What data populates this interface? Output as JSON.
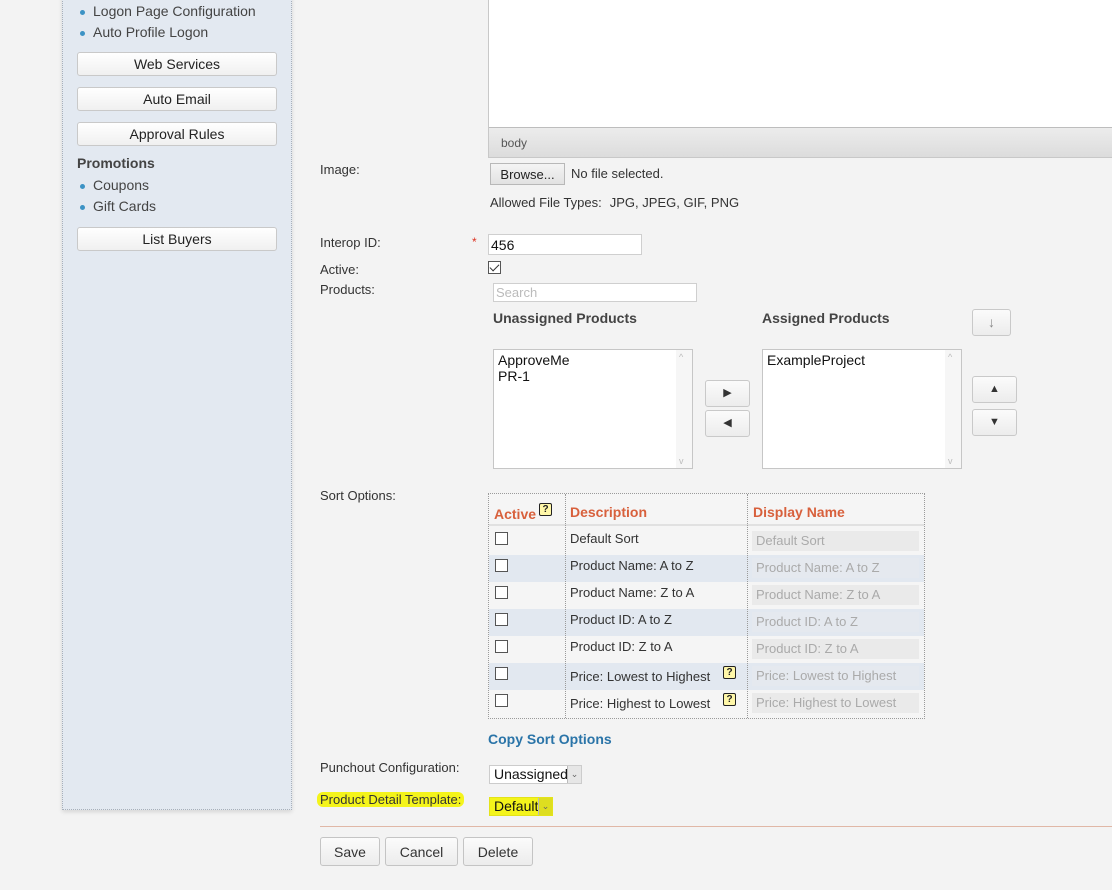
{
  "sidebar": {
    "links_top": [
      {
        "label": "Logon Page Configuration"
      },
      {
        "label": "Auto Profile Logon"
      }
    ],
    "buttons": [
      {
        "label": "Web Services"
      },
      {
        "label": "Auto Email"
      },
      {
        "label": "Approval Rules"
      }
    ],
    "section_promotions": {
      "title": "Promotions",
      "links": [
        {
          "label": "Coupons"
        },
        {
          "label": "Gift Cards"
        }
      ]
    },
    "list_buyers_label": "List Buyers"
  },
  "editor": {
    "status_path": "body"
  },
  "form": {
    "image": {
      "label": "Image:",
      "browse_label": "Browse...",
      "file_status": "No file selected.",
      "allowed_label": "Allowed File Types:",
      "allowed_types": "JPG, JPEG, GIF, PNG"
    },
    "interop_id": {
      "label": "Interop ID:",
      "required_mark": "*",
      "value": "456"
    },
    "active": {
      "label": "Active:",
      "checked": true
    },
    "products": {
      "label": "Products:",
      "search_placeholder": "Search",
      "unassigned_title": "Unassigned Products",
      "assigned_title": "Assigned Products",
      "unassigned_items": [
        "ApproveMe",
        "PR-1"
      ],
      "assigned_items": [
        "ExampleProject"
      ],
      "move_right_icon": "triangle-right",
      "move_left_icon": "triangle-left",
      "move_up_icon": "triangle-up",
      "move_down_icon": "triangle-down",
      "sort_down_icon": "arrow-down"
    },
    "sort_options": {
      "label": "Sort Options:",
      "headers": {
        "active": "Active",
        "description": "Description",
        "display_name": "Display Name"
      },
      "header_color": "#d8603c",
      "rows": [
        {
          "active": false,
          "description": "Default Sort",
          "display_name": "Default Sort",
          "help": false
        },
        {
          "active": false,
          "description": "Product Name: A to Z",
          "display_name": "Product Name: A to Z",
          "help": false
        },
        {
          "active": false,
          "description": "Product Name: Z to A",
          "display_name": "Product Name: Z to A",
          "help": false
        },
        {
          "active": false,
          "description": "Product ID: A to Z",
          "display_name": "Product ID: A to Z",
          "help": false
        },
        {
          "active": false,
          "description": "Product ID: Z to A",
          "display_name": "Product ID: Z to A",
          "help": false
        },
        {
          "active": false,
          "description": "Price: Lowest to Highest",
          "display_name": "Price: Lowest to Highest",
          "help": true
        },
        {
          "active": false,
          "description": "Price: Highest to Lowest",
          "display_name": "Price: Highest to Lowest",
          "help": true
        }
      ],
      "help_glyph": "?",
      "copy_link": "Copy Sort Options"
    },
    "punchout": {
      "label": "Punchout Configuration:",
      "selected": "Unassigned"
    },
    "product_detail_template": {
      "label": "Product Detail Template:",
      "selected": "Default",
      "highlight_color": "#f4f41b"
    }
  },
  "actions": {
    "save": "Save",
    "cancel": "Cancel",
    "delete": "Delete"
  },
  "glyphs": {
    "right": "▶",
    "left": "◀",
    "up": "▲",
    "down": "▼",
    "arrow_down": "↓",
    "chevron": "⌄",
    "scroll_up": "^",
    "scroll_down": "v"
  }
}
